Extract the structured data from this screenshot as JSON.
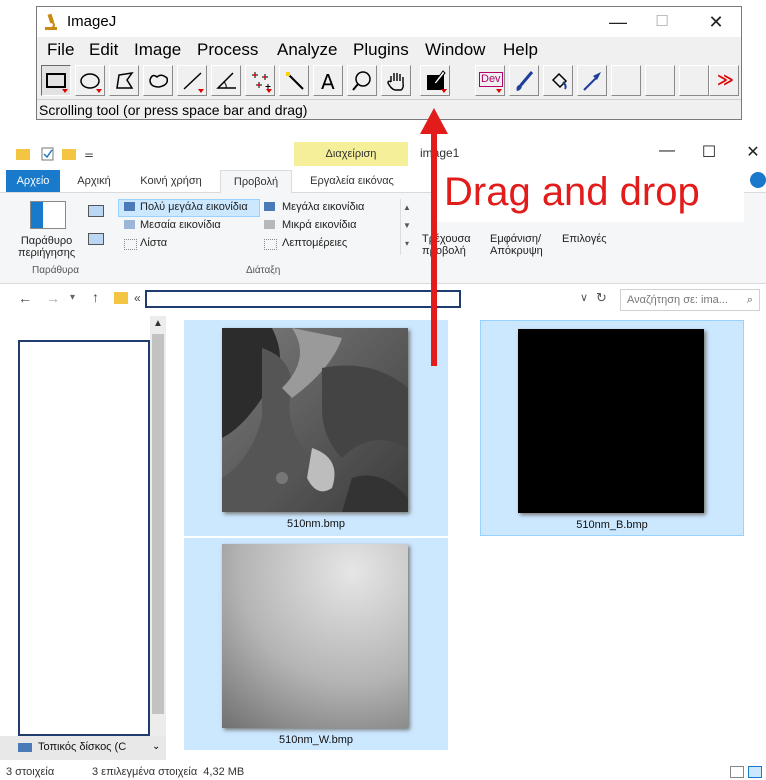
{
  "imagej": {
    "title": "ImageJ",
    "window_buttons": [
      "—",
      "☐",
      "✕"
    ],
    "menus": [
      "File",
      "Edit",
      "Image",
      "Process",
      "Analyze",
      "Plugins",
      "Window",
      "Help"
    ],
    "tools": [
      "rectangle-tool",
      "oval-tool",
      "polygon-tool",
      "freehand-tool",
      "line-tool",
      "angle-tool",
      "point-tool",
      "wand-tool",
      "text-tool",
      "magnifier-tool",
      "scroll-tool",
      "color-picker-tool",
      "dev-tool",
      "brush-tool",
      "flood-fill-tool",
      "arrow-tool"
    ],
    "dev_label": "Dev",
    "more_label": "≫",
    "status": "Scrolling tool (or press space bar and drag)"
  },
  "explorer": {
    "tools_header": "Διαχείριση",
    "window_title": "image1",
    "window_buttons": [
      "—",
      "☐",
      "✕"
    ],
    "tabs": [
      "Αρχείο",
      "Αρχική",
      "Κοινή χρήση",
      "Προβολή",
      "Εργαλεία εικόνας"
    ],
    "ribbon": {
      "nav_pane_label": "Παράθυρο\nπεριήγησης",
      "panes_group": "Παράθυρα",
      "layout_items": [
        "Πολύ μεγάλα εικονίδια",
        "Μεγάλα εικονίδια",
        "Μεσαία εικονίδια",
        "Μικρά εικονίδια",
        "Λίστα",
        "Λεπτομέρειες"
      ],
      "layout_group": "Διάταξη",
      "current_view": "Τρέχουσα\nπροβολή",
      "show_hide": "Εμφάνιση/\nΑπόκρυψη",
      "options": "Επιλογές"
    },
    "address_prefix": "«",
    "search_placeholder": "Αναζήτηση σε: ima...",
    "nav_drive": "Τοπικός δίσκος (C",
    "files": [
      {
        "name": "510nm.bmp"
      },
      {
        "name": "510nm_B.bmp"
      },
      {
        "name": "510nm_W.bmp"
      }
    ],
    "status": {
      "items": "3 στοιχεία",
      "selected": "3 επιλεγμένα στοιχεία  4,32 MB"
    }
  },
  "annotation": {
    "text": "Drag and drop",
    "color": "#e21b1b"
  }
}
